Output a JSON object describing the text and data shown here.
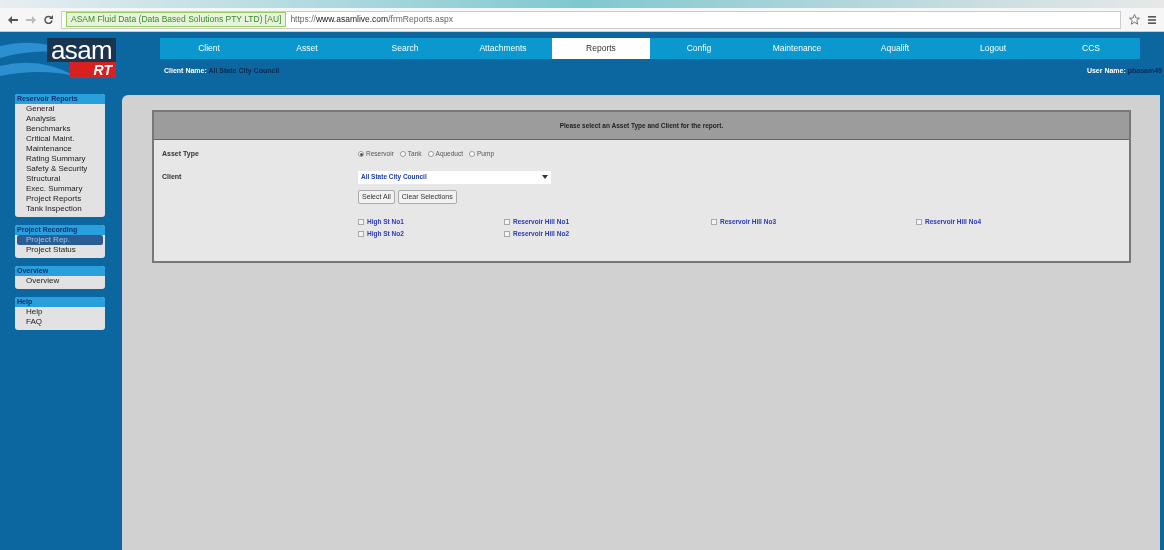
{
  "browser": {
    "site_identity": "ASAM Fluid Data (Data Based Solutions PTY LTD) [AU]",
    "url_scheme": "https://",
    "url_host": "www.asamlive.com",
    "url_path": "/frmReports.aspx"
  },
  "logo": {
    "top": "asam",
    "bottom": "RT"
  },
  "nav": [
    {
      "label": "Client",
      "selected": false
    },
    {
      "label": "Asset",
      "selected": false
    },
    {
      "label": "Search",
      "selected": false
    },
    {
      "label": "Attachments",
      "selected": false
    },
    {
      "label": "Reports",
      "selected": true
    },
    {
      "label": "Config",
      "selected": false
    },
    {
      "label": "Maintenance",
      "selected": false
    },
    {
      "label": "Aqualift",
      "selected": false
    },
    {
      "label": "Logout",
      "selected": false
    },
    {
      "label": "CCS",
      "selected": false
    }
  ],
  "client_name": {
    "label": "Client Name:",
    "value": "All State City Council"
  },
  "user_name": {
    "label": "User Name:",
    "value": "pbasam49"
  },
  "sidebar": [
    {
      "title": "Reservoir Reports",
      "items": [
        {
          "label": "General",
          "selected": false
        },
        {
          "label": "Analysis",
          "selected": false
        },
        {
          "label": "Benchmarks",
          "selected": false
        },
        {
          "label": "Critical Maint.",
          "selected": false
        },
        {
          "label": "Maintenance",
          "selected": false
        },
        {
          "label": "Rating Summary",
          "selected": false
        },
        {
          "label": "Safety & Security",
          "selected": false
        },
        {
          "label": "Structural",
          "selected": false
        },
        {
          "label": "Exec. Summary",
          "selected": false
        },
        {
          "label": "Project Reports",
          "selected": false
        },
        {
          "label": "Tank Inspection",
          "selected": false
        }
      ]
    },
    {
      "title": "Project Recording",
      "items": [
        {
          "label": "Project Rep.",
          "selected": true
        },
        {
          "label": "Project Status",
          "selected": false
        }
      ]
    },
    {
      "title": "Overview",
      "items": [
        {
          "label": "Overview",
          "selected": false
        }
      ]
    },
    {
      "title": "Help",
      "items": [
        {
          "label": "Help",
          "selected": false
        },
        {
          "label": "FAQ",
          "selected": false
        }
      ]
    }
  ],
  "form": {
    "heading": "Please select an Asset Type and Client for the report.",
    "asset_type_label": "Asset Type",
    "asset_types": [
      {
        "label": "Reservoir",
        "selected": true
      },
      {
        "label": "Tank",
        "selected": false
      },
      {
        "label": "Aqueduct",
        "selected": false
      },
      {
        "label": "Pump",
        "selected": false
      }
    ],
    "client_label": "Client",
    "client_value": "All State City Council",
    "buttons": [
      "Select All",
      "Clear Selections"
    ],
    "assets": [
      [
        {
          "label": "High St No1",
          "checked": false
        },
        {
          "label": "Reservoir Hill No1",
          "checked": false
        },
        {
          "label": "Reservoir Hill No3",
          "checked": false
        },
        {
          "label": "Reservoir Hill No4",
          "checked": false
        }
      ],
      [
        {
          "label": "High St No2",
          "checked": false
        },
        {
          "label": "Reservoir Hill No2",
          "checked": false
        }
      ]
    ]
  }
}
